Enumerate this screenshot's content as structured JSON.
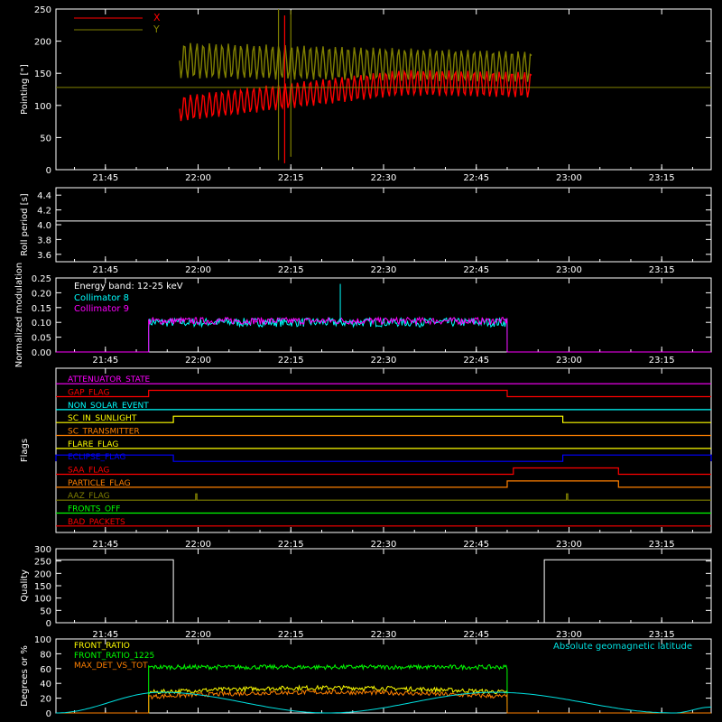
{
  "colors": {
    "background": "#000000",
    "axes": "#ffffff",
    "x_pointing": "#ff0000",
    "y_pointing": "#808000",
    "collimator8": "#00ffff",
    "collimator9": "#ff00ff",
    "front_ratio": "#ffff00",
    "front_ratio_1225": "#00ff00",
    "max_det_vs_tot": "#ff8000",
    "geomag": "#00e0e0"
  },
  "time_ticks": [
    "21:45",
    "22:00",
    "22:15",
    "22:30",
    "22:45",
    "23:00",
    "23:15"
  ],
  "chart_data": [
    {
      "id": "pointing",
      "type": "line",
      "ylabel": "Pointing [\"]",
      "ylim": [
        0,
        250
      ],
      "yticks": [
        0,
        50,
        100,
        150,
        200,
        250
      ],
      "legend_placement": "top-left",
      "series": [
        {
          "name": "X",
          "color": "#ff0000",
          "center_start": 95,
          "center_end": 135,
          "amplitude": 20
        },
        {
          "name": "Y",
          "color": "#808000",
          "center_start": 170,
          "center_end": 160,
          "amplitude": 28
        }
      ],
      "x_range": [
        "21:57",
        "22:54"
      ],
      "reference_line": 128,
      "spikes": [
        {
          "time": "22:13",
          "from": 15,
          "to": 250
        },
        {
          "time": "22:14",
          "from": 10,
          "to": 240
        },
        {
          "time": "22:15",
          "from": 20,
          "to": 248
        }
      ]
    },
    {
      "id": "roll",
      "type": "line",
      "ylabel": "Roll period [s]",
      "ylim": [
        3.5,
        4.5
      ],
      "yticks": [
        3.6,
        3.8,
        4.0,
        4.2,
        4.4
      ],
      "series": [
        {
          "name": "",
          "color": "#ffffff",
          "value": 4.05
        }
      ]
    },
    {
      "id": "modulation",
      "type": "line",
      "ylabel": "Normalized modulation",
      "ylim": [
        0,
        0.25
      ],
      "yticks": [
        0.0,
        0.05,
        0.1,
        0.15,
        0.2,
        0.25
      ],
      "legend_placement": "top-left",
      "annotation": "Energy band: 12-25 keV",
      "x_range": [
        "21:52",
        "22:50"
      ],
      "series": [
        {
          "name": "Collimator 8",
          "color": "#00ffff",
          "mean": 0.1,
          "noise": 0.015
        },
        {
          "name": "Collimator 9",
          "color": "#ff00ff",
          "mean": 0.105,
          "noise": 0.012
        }
      ],
      "spike": {
        "time": "22:23",
        "value": 0.23
      }
    },
    {
      "id": "flags",
      "type": "line",
      "ylabel": "Flags",
      "flags": [
        {
          "name": "ATTENUATOR_STATE",
          "color": "#ff00ff",
          "segments": []
        },
        {
          "name": "GAP_FLAG",
          "color": "#ff0000",
          "segments": [
            [
              "21:52",
              "22:50"
            ]
          ]
        },
        {
          "name": "NON_SOLAR_EVENT",
          "color": "#00ffff",
          "segments": []
        },
        {
          "name": "SC_IN_SUNLIGHT",
          "color": "#ffff00",
          "segments": [
            [
              "21:56",
              "22:59"
            ]
          ]
        },
        {
          "name": "SC_TRANSMITTER",
          "color": "#ff8000",
          "segments": []
        },
        {
          "name": "FLARE_FLAG",
          "color": "#ffff00",
          "segments": []
        },
        {
          "name": "ECLIPSE_FLAG",
          "color": "#0000ff",
          "segments": [
            [
              "21:37",
              "21:56"
            ],
            [
              "22:59",
              "23:23"
            ]
          ]
        },
        {
          "name": "SAA_FLAG",
          "color": "#ff0000",
          "segments": [
            [
              "22:51",
              "23:08"
            ]
          ]
        },
        {
          "name": "PARTICLE_FLAG",
          "color": "#ff8000",
          "segments": [
            [
              "22:50",
              "23:08"
            ]
          ]
        },
        {
          "name": "AAZ_FLAG",
          "color": "#808000",
          "segments": [
            [
              "21:59.6",
              "21:59.8"
            ],
            [
              "22:59.6",
              "22:59.8"
            ]
          ]
        },
        {
          "name": "FRONTS_OFF",
          "color": "#00ff00",
          "segments": []
        },
        {
          "name": "BAD_PACKETS",
          "color": "#ff0000",
          "segments": []
        }
      ]
    },
    {
      "id": "quality",
      "type": "line",
      "ylabel": "Quality",
      "ylim": [
        0,
        300
      ],
      "yticks": [
        0,
        50,
        100,
        150,
        200,
        250,
        300
      ],
      "series": [
        {
          "name": "",
          "color": "#ffffff",
          "segments": [
            [
              "21:37",
              "21:56",
              255
            ],
            [
              "21:56",
              "22:56",
              0
            ],
            [
              "22:56",
              "23:23",
              255
            ]
          ]
        }
      ]
    },
    {
      "id": "ratios",
      "type": "line",
      "ylabel": "Degrees or %",
      "ylim": [
        0,
        100
      ],
      "yticks": [
        0,
        20,
        40,
        60,
        80,
        100
      ],
      "legend_placement": "top-left",
      "x_range": [
        "21:52",
        "22:50"
      ],
      "series": [
        {
          "name": "FRONT_RATIO",
          "color": "#ffff00",
          "mean": 28,
          "noise": 3
        },
        {
          "name": "FRONT_RATIO_1225",
          "color": "#00ff00",
          "mean": 62,
          "noise": 3
        },
        {
          "name": "MAX_DET_VS_TOT",
          "color": "#ff8000",
          "mean": 22,
          "noise": 3
        },
        {
          "name": "Absolute geomagnetic latitude",
          "color": "#00e0e0",
          "peaks": [
            [
              "21:37",
              0
            ],
            [
              "21:54",
              28
            ],
            [
              "22:21",
              0
            ],
            [
              "22:48",
              28
            ],
            [
              "23:17",
              0
            ],
            [
              "23:23",
              8
            ]
          ]
        }
      ]
    }
  ]
}
